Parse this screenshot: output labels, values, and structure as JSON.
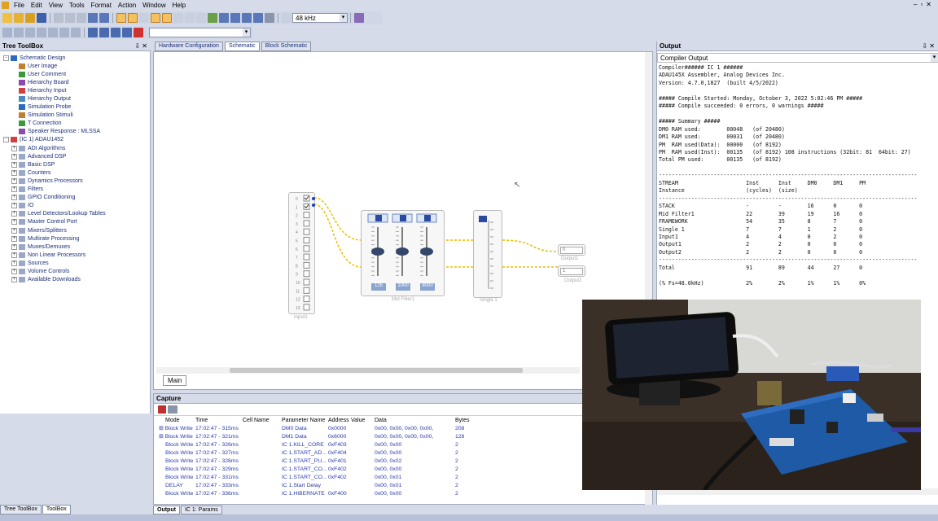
{
  "menu": [
    "File",
    "Edit",
    "View",
    "Tools",
    "Format",
    "Action",
    "Window",
    "Help"
  ],
  "toolbar": {
    "sample_rate": "48 kHz"
  },
  "tree": {
    "title": "Tree ToolBox",
    "pin": "⇩ ✕",
    "items": [
      {
        "label": "Schematic Design",
        "level": 0,
        "exp": "-"
      },
      {
        "label": "User Image",
        "level": 1
      },
      {
        "label": "User Comment",
        "level": 1
      },
      {
        "label": "Hierarchy Board",
        "level": 1
      },
      {
        "label": "Hierarchy Input",
        "level": 1
      },
      {
        "label": "Hierarchy Output",
        "level": 1
      },
      {
        "label": "Simulation Probe",
        "level": 1
      },
      {
        "label": "Simulation Stimuli",
        "level": 1
      },
      {
        "label": "T Connection",
        "level": 1
      },
      {
        "label": "Speaker Response : MLSSA",
        "level": 1
      },
      {
        "label": "(IC 1) ADAU1452",
        "level": 0,
        "exp": "-"
      },
      {
        "label": "ADI Algorithms",
        "level": 1,
        "exp": "+"
      },
      {
        "label": "Advanced DSP",
        "level": 1,
        "exp": "+"
      },
      {
        "label": "Basic DSP",
        "level": 1,
        "exp": "+"
      },
      {
        "label": "Counters",
        "level": 1,
        "exp": "+"
      },
      {
        "label": "Dynamics Processors",
        "level": 1,
        "exp": "+"
      },
      {
        "label": "Filters",
        "level": 1,
        "exp": "+"
      },
      {
        "label": "GPIO Conditioning",
        "level": 1,
        "exp": "+"
      },
      {
        "label": "IO",
        "level": 1,
        "exp": "+"
      },
      {
        "label": "Level Detectors/Lookup Tables",
        "level": 1,
        "exp": "+"
      },
      {
        "label": "Master Control Port",
        "level": 1,
        "exp": "+"
      },
      {
        "label": "Mixers/Splitters",
        "level": 1,
        "exp": "+"
      },
      {
        "label": "Multirate Processing",
        "level": 1,
        "exp": "+"
      },
      {
        "label": "Muxes/Demuxes",
        "level": 1,
        "exp": "+"
      },
      {
        "label": "Non Linear Processors",
        "level": 1,
        "exp": "+"
      },
      {
        "label": "Sources",
        "level": 1,
        "exp": "+"
      },
      {
        "label": "Volume Controls",
        "level": 1,
        "exp": "+"
      },
      {
        "label": "Available Downloads",
        "level": 1,
        "exp": "+"
      }
    ]
  },
  "bottom_tabs": [
    "Tree ToolBox",
    "ToolBox"
  ],
  "doc": {
    "tabs": [
      "Hardware Configuration",
      "Schematic",
      "Block Schematic"
    ],
    "active": 1,
    "main_tab": "Main"
  },
  "blocks": {
    "input_label": "Input1",
    "filter_label": "Mid Filter1",
    "single_label": "Single 1",
    "output1_label": "Output1",
    "output2_label": "Output2",
    "freqs": [
      "125",
      "1000",
      "8000"
    ],
    "out_values": [
      "0",
      "1"
    ]
  },
  "capture": {
    "title": "Capture",
    "headers": [
      "Mode",
      "Time",
      "Cell Name",
      "Parameter Name",
      "Address",
      "Value",
      "Data",
      "Bytes"
    ],
    "rows": [
      [
        "Block Write",
        "17:02:47 - 315ms",
        "",
        "DM0 Data",
        "0x0000",
        "",
        "0x00, 0x00, 0x00, 0x00,",
        "208"
      ],
      [
        "Block Write",
        "17:02:47 - 321ms",
        "",
        "DM1 Data",
        "0x6000",
        "",
        "0x00, 0x00, 0x00, 0x00,",
        "128"
      ],
      [
        "Block Write",
        "17:02:47 - 326ms",
        "",
        "IC 1.KILL_CORE",
        "0xF403",
        "",
        "0x00, 0x00",
        "2"
      ],
      [
        "Block Write",
        "17:02:47 - 327ms",
        "",
        "IC 1.START_AD...",
        "0xF404",
        "",
        "0x00, 0x00",
        "2"
      ],
      [
        "Block Write",
        "17:02:47 - 328ms",
        "",
        "IC 1.START_PU...",
        "0xF401",
        "",
        "0x00, 0x02",
        "2"
      ],
      [
        "Block Write",
        "17:02:47 - 329ms",
        "",
        "IC 1.START_CO...",
        "0xF402",
        "",
        "0x00, 0x00",
        "2"
      ],
      [
        "Block Write",
        "17:02:47 - 331ms",
        "",
        "IC 1.START_CO...",
        "0xF402",
        "",
        "0x00, 0x01",
        "2"
      ],
      [
        "DELAY",
        "17:02:47 - 333ms",
        "",
        "IC 1.Start Delay",
        "",
        "",
        "0x00, 0x01",
        "2"
      ],
      [
        "Block Write",
        "17:02:47 - 336ms",
        "",
        "IC 1.HIBERNATE",
        "0xF400",
        "",
        "0x00, 0x00",
        "2"
      ]
    ]
  },
  "capture_tabs": [
    "Output",
    "IC 1: Params"
  ],
  "output": {
    "title": "Output",
    "pin": "⇩ ✕",
    "selector": "Compiler Output",
    "lines": [
      "Compiler###### IC 1 ######",
      "ADAU145X Assembler, Analog Devices Inc.",
      "Version: 4.7.0,1827  (built 4/5/2022)",
      "",
      "##### Compile Started: Monday, October 3, 2022 5:02:46 PM #####",
      "##### Compile succeeded: 0 errors, 0 warnings #####",
      "",
      "##### Summary #####",
      "DM0 RAM used:        00048   (of 20480)",
      "DM1 RAM used:        00031   (of 20480)",
      "PM  RAM used(Data):  00000   (of 8192)",
      "PM  RAM used(Inst):  00135   (of 8192) 108 instructions (32bit: 81  64bit: 27)",
      "Total PM used:       00135   (of 8192)",
      "",
      "--------------------------------------------------------------------------------",
      "STREAM                     Inst      Inst     DM0     DM1     PM",
      "Instance                   (cycles)  (size)",
      "--------------------------------------------------------------------------------",
      "STACK                      -         -        16      0       0",
      "Mid Filter1                22        39       19      16      0",
      "FRAMEWORK                  54        35       8       7       0",
      "Single 1                   7         7        1       2       0",
      "Input1                     4         4        0       2       0",
      "Output1                    2         2        0       0       0",
      "Output2                    2         2        0       0       0",
      "--------------------------------------------------------------------------------",
      "Total                      91        89       44      27      0",
      "",
      "(% Fs=48.0kHz)             2%        2%       1%      1%      0%"
    ]
  }
}
